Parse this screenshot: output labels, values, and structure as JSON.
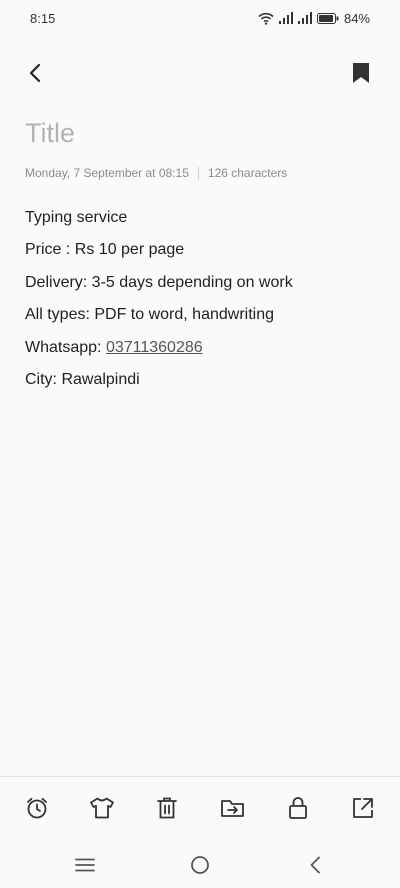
{
  "status_bar": {
    "time": "8:15",
    "battery_percent": "84%",
    "icons": [
      "wifi-icon",
      "signal-icon",
      "signal-icon",
      "battery-icon"
    ]
  },
  "toolbar": {
    "back_icon": "chevron-left-icon",
    "bookmark_icon": "bookmark-icon"
  },
  "note": {
    "title_placeholder": "Title",
    "meta_date": "Monday, 7 September at 08:15",
    "meta_chars": "126 characters",
    "lines": [
      "Typing service",
      "Price : Rs 10 per page",
      "Delivery:  3-5 days depending on work",
      "All types: PDF to word, handwriting"
    ],
    "whatsapp_label": "Whatsapp: ",
    "whatsapp_number": "03711360286",
    "city_line": "City: Rawalpindi"
  },
  "bottom_toolbar": {
    "items": [
      "alarm-icon",
      "theme-shirt-icon",
      "delete-icon",
      "move-folder-icon",
      "lock-icon",
      "share-icon"
    ]
  },
  "nav_bar": {
    "items": [
      "menu-icon",
      "home-icon",
      "back-icon"
    ]
  }
}
